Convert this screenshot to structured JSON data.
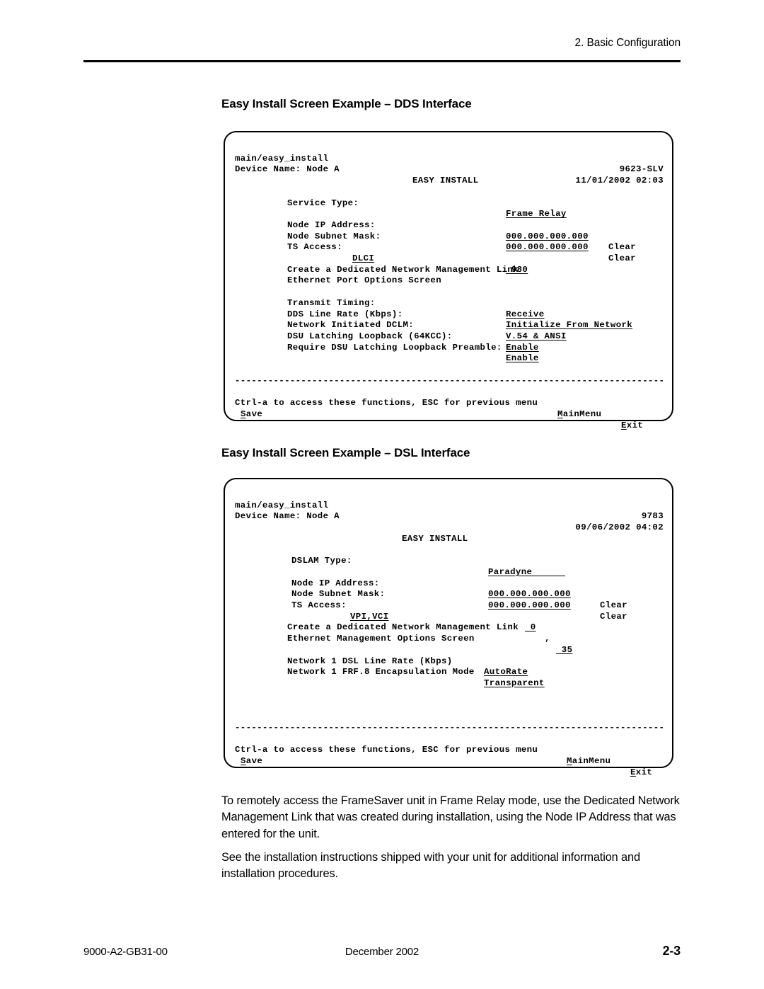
{
  "header": {
    "chapter": "2. Basic Configuration"
  },
  "footer": {
    "doc_number": "9000-A2-GB31-00",
    "date": "December 2002",
    "page_number": "2-3"
  },
  "sections": {
    "dds_heading": "Easy Install Screen Example – DDS Interface",
    "dsl_heading": "Easy Install Screen Example – DSL Interface"
  },
  "separator": "---------------------------------------------------------------------------------",
  "dds_screen": {
    "path": "main/easy_install",
    "model": "9623-SLV",
    "device_name": "Device Name: Node A",
    "timestamp": "11/01/2002 02:03",
    "title": "EASY INSTALL",
    "fields": [
      {
        "label": "Service Type:",
        "value": "Frame Relay"
      },
      {
        "label": "Node IP Address:",
        "value": "000.000.000.000",
        "suffix": "Clear"
      },
      {
        "label": "Node Subnet Mask:",
        "value": "000.000.000.000",
        "suffix": "Clear"
      },
      {
        "label": "TS Access:",
        "option": "DLCI",
        "value": " 980"
      }
    ],
    "links": [
      "Create a Dedicated Network Management Link",
      "Ethernet Port Options Screen"
    ],
    "options": [
      {
        "label": "Transmit Timing:",
        "value": "Receive"
      },
      {
        "label": "DDS Line Rate (Kbps):",
        "value": "Initialize From Network"
      },
      {
        "label": "Network Initiated DCLM:",
        "value": "V.54 & ANSI"
      },
      {
        "label": "DSU Latching Loopback (64KCC):",
        "value": "Enable"
      },
      {
        "label": "Require DSU Latching Loopback Preamble:",
        "value": "Enable"
      }
    ],
    "help_text": "Ctrl-a to access these functions, ESC for previous menu",
    "commands": {
      "mainmenu_key": "M",
      "mainmenu_rest": "ainMenu",
      "exit_key": "E",
      "exit_rest": "xit",
      "save_key": "S",
      "save_rest": "ave"
    }
  },
  "dsl_screen": {
    "path": "main/easy_install",
    "model": "9783",
    "device_name": "Device Name: Node A",
    "timestamp": "09/06/2002 04:02",
    "title": "EASY INSTALL",
    "fields": [
      {
        "label": "DSLAM Type:",
        "value": "Paradyne",
        "field_pad": "Paradyne      "
      },
      {
        "label": "Node IP Address:",
        "value": "000.000.000.000",
        "suffix": "Clear"
      },
      {
        "label": "Node Subnet Mask:",
        "value": "000.000.000.000",
        "suffix": "Clear"
      },
      {
        "label": "TS Access:",
        "option": "VPI,VCI",
        "vpi": " 0",
        "separator": ",",
        "vci": " 35"
      }
    ],
    "links": [
      "Create a Dedicated Network Management Link",
      "Ethernet Management Options Screen"
    ],
    "options": [
      {
        "label": "Network 1 DSL Line Rate (Kbps)",
        "value": "AutoRate"
      },
      {
        "label": "Network 1 FRF.8 Encapsulation Mode",
        "value": "Transparent"
      }
    ],
    "help_text": "Ctrl-a to access these functions, ESC for previous menu",
    "commands": {
      "mainmenu_key": "M",
      "mainmenu_rest": "ainMenu",
      "exit_key": "E",
      "exit_rest": "xit",
      "save_key": "S",
      "save_rest": "ave"
    }
  },
  "body": {
    "paragraph_1": "To remotely access the FrameSaver unit in Frame Relay mode, use the Dedicated Network Management Link that was created during installation, using the Node IP Address that was entered for the unit.",
    "paragraph_2": "See the installation instructions shipped with your unit for additional information and installation procedures."
  }
}
